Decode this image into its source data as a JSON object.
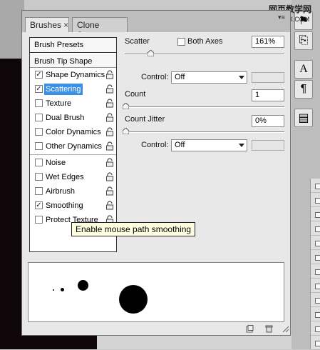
{
  "watermark": {
    "line1": "网页教学网",
    "line2": "WEBJX.COM"
  },
  "tabs": [
    {
      "label": "Brushes",
      "close": "×"
    },
    {
      "label": "Clone Source"
    }
  ],
  "brush_list": {
    "presets_label": "Brush Presets",
    "tip_label": "Brush Tip Shape",
    "items": [
      {
        "label": "Shape Dynamics",
        "checked": "✓"
      },
      {
        "label": "Scattering",
        "checked": "✓"
      },
      {
        "label": "Texture",
        "checked": ""
      },
      {
        "label": "Dual Brush",
        "checked": ""
      },
      {
        "label": "Color Dynamics",
        "checked": ""
      },
      {
        "label": "Other Dynamics",
        "checked": ""
      },
      {
        "label": "Noise",
        "checked": ""
      },
      {
        "label": "Wet Edges",
        "checked": ""
      },
      {
        "label": "Airbrush",
        "checked": ""
      },
      {
        "label": "Smoothing",
        "checked": "✓"
      },
      {
        "label": "Protect Texture",
        "checked": ""
      }
    ],
    "selected": "Scattering"
  },
  "scatter": {
    "label": "Scatter",
    "both_axes_label": "Both Axes",
    "value": "161%",
    "control_label": "Control:",
    "control_value": "Off"
  },
  "count": {
    "label": "Count",
    "value": "1"
  },
  "count_jitter": {
    "label": "Count Jitter",
    "value": "0%",
    "control_label": "Control:",
    "control_value": "Off"
  },
  "tooltip": "Enable mouse path smoothing",
  "colors": {
    "selection": "#3b8fe6",
    "panel_bg": "#e8e8e8"
  }
}
